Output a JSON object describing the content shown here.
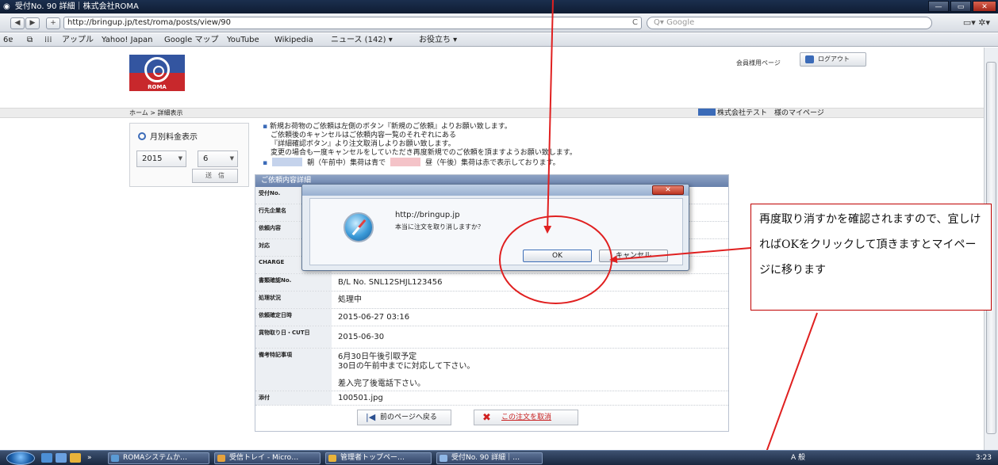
{
  "window": {
    "title": "受付No. 90 詳細｜株式会社ROMA",
    "controls": [
      "—",
      "▭",
      "✕"
    ]
  },
  "browser": {
    "back": "◀",
    "forward": "▶",
    "add": "+",
    "url": "http://bringup.jp/test/roma/posts/view/90",
    "reload": "C",
    "search_placeholder": "Q▾ Google",
    "tools": "▭▾ ✲▾"
  },
  "bookmarks": {
    "icons": [
      "6ɐ",
      "⧉",
      "⁞⁞⁞"
    ],
    "items": [
      "アップル",
      "Yahoo! Japan",
      "Google マップ",
      "YouTube",
      "Wikipedia",
      "ニュース (142) ▾",
      "お役立ち ▾"
    ]
  },
  "header": {
    "logo_text": "ROMA",
    "member_link": "会員様用ページ",
    "logout": "ログアウト"
  },
  "breadcrumb": {
    "path": "ホーム > 詳細表示",
    "mypage": "株式会社テスト　様のマイページ"
  },
  "sidebar": {
    "title": "月別料金表示",
    "year": "2015",
    "month": "6",
    "send": "送　信"
  },
  "notice": {
    "line1": "新規お荷物のご依頼は左側のボタン『新規のご依頼』よりお願い致します。",
    "line2": "ご依頼後のキャンセルはご依頼内容一覧のそれぞれにある",
    "line3": "『詳細確認ボタン』より注文取消しよりお願い致します。",
    "line4": "変更の場合も一度キャンセルをしていただき再度新規でのご依頼を頂ますようお願い致します。",
    "legend_am": "朝（午前中）集荷は青で",
    "legend_pm": "昼（午後）集荷は赤で表示しております。",
    "am_color": "#c5d3ec",
    "pm_color": "#f4c3c8"
  },
  "detail": {
    "heading": "ご依頼内容詳細",
    "rows": [
      {
        "label": "受付No.",
        "value": ""
      },
      {
        "label": "行先企業名",
        "value": ""
      },
      {
        "label": "依頼内容",
        "value": ""
      },
      {
        "label": "対応",
        "value": ""
      },
      {
        "label": "CHARGE",
        "value": ""
      },
      {
        "label": "書類確認No.",
        "value": "B/L No. SNL12SHJL123456"
      },
      {
        "label": "処理状況",
        "value": "処理中"
      },
      {
        "label": "依頼確定日時",
        "value": "2015-06-27 03:16"
      },
      {
        "label": "貨物取り日・CUT日",
        "value": "2015-06-30"
      },
      {
        "label": "備考特記事項",
        "lines": [
          "6月30日午後引取予定",
          "30日の午前中までに対応して下さい。",
          "",
          "差入完了後電話下さい。"
        ]
      },
      {
        "label": "添付",
        "value": "100501.jpg"
      }
    ],
    "back_button": "前のページへ戻る",
    "cancel_button": "この注文を取消"
  },
  "dialog": {
    "host": "http://bringup.jp",
    "message": "本当に注文を取り消しますか？",
    "ok": "OK",
    "cancel": "キャンセル",
    "close": "✕"
  },
  "annotation": {
    "text": "再度取り消すかを確認されますので、宜しければOKをクリックして頂きますとマイページに移ります",
    "color": "#e02020"
  },
  "taskbar": {
    "items": [
      "ROMAシステムか…",
      "受信トレイ - Micro…",
      "管理者トップペー…",
      "受付No. 90 詳細｜…"
    ],
    "ime": "A 般",
    "clock": "3:23"
  }
}
